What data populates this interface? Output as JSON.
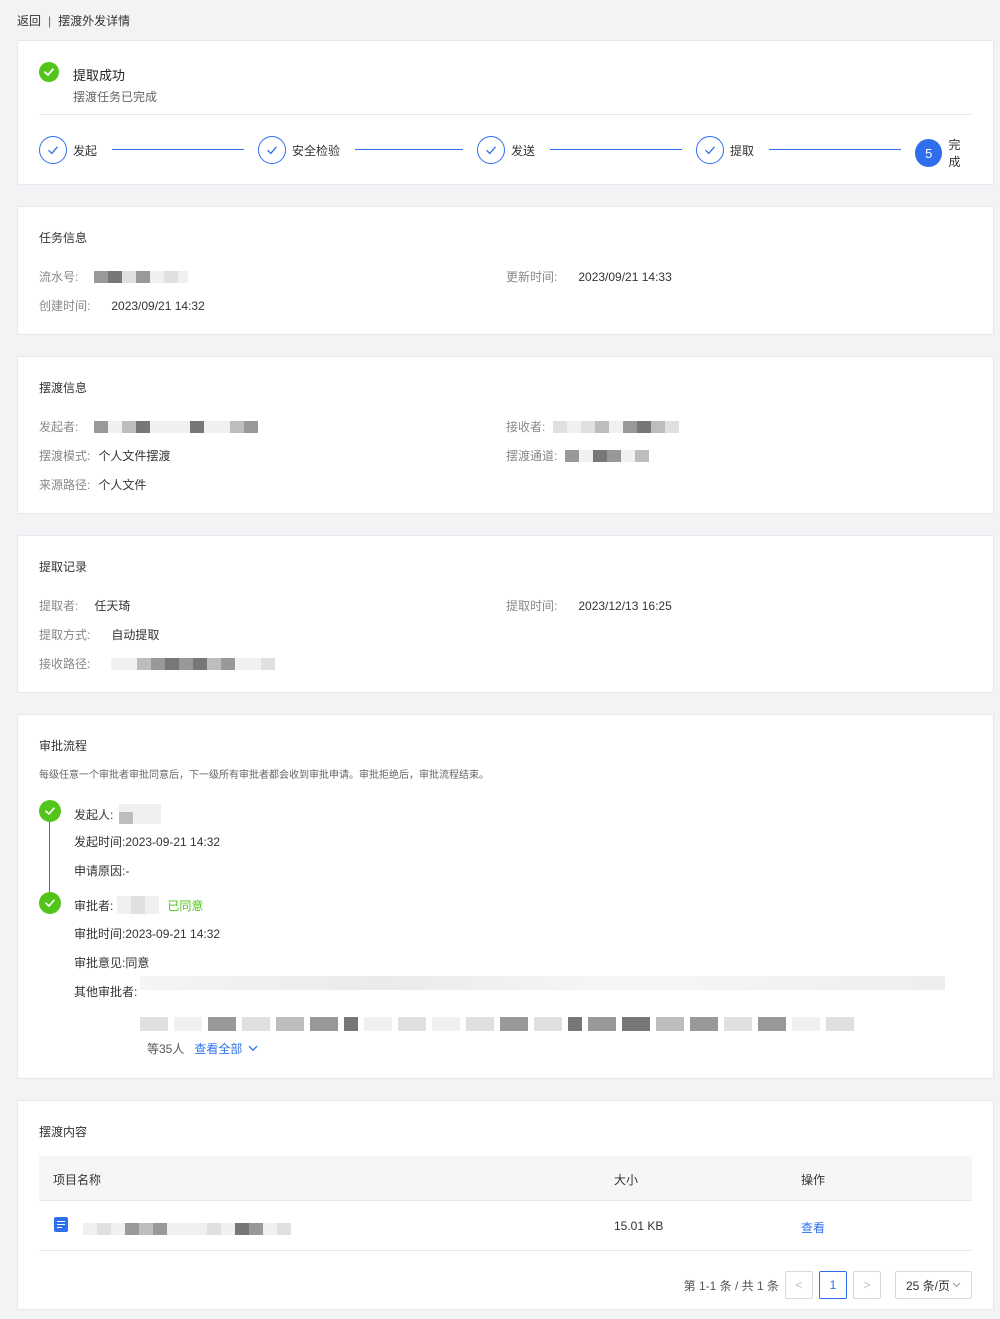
{
  "topbar": {
    "back_label": "返回",
    "separator": "|",
    "page_title": "摆渡外发详情"
  },
  "status": {
    "title": "提取成功",
    "subtitle": "摆渡任务已完成",
    "steps": [
      {
        "label": "发起",
        "state": "done"
      },
      {
        "label": "安全检验",
        "state": "done"
      },
      {
        "label": "发送",
        "state": "done"
      },
      {
        "label": "提取",
        "state": "done"
      },
      {
        "label": "完成",
        "state": "active",
        "number": "5"
      }
    ]
  },
  "task_info": {
    "title": "任务信息",
    "serial_label": "流水号:",
    "created_label": "创建时间:",
    "created_value": "2023/09/21 14:32",
    "updated_label": "更新时间:",
    "updated_value": "2023/09/21 14:33"
  },
  "ferry_info": {
    "title": "摆渡信息",
    "sender_label": "发起者:",
    "mode_label": "摆渡模式:",
    "mode_value": "个人文件摆渡",
    "source_label": "来源路径:",
    "source_value": "个人文件",
    "receiver_label": "接收者:",
    "channel_label": "摆渡通道:"
  },
  "extract_record": {
    "title": "提取记录",
    "extractor_label": "提取者:",
    "extractor_value": "任天琦",
    "method_label": "提取方式:",
    "method_value": "自动提取",
    "path_label": "接收路径:",
    "time_label": "提取时间:",
    "time_value": "2023/12/13 16:25"
  },
  "approval": {
    "title": "审批流程",
    "description": "每级任意一个审批者审批同意后，下一级所有审批者都会收到审批申请。审批拒绝后，审批流程结束。",
    "initiator_label": "发起人:",
    "initiate_time_label": "发起时间:",
    "initiate_time_value": "2023-09-21 14:32",
    "reason_label": "申请原因:",
    "reason_value": "-",
    "approver_label": "审批者:",
    "approver_status": "已同意",
    "approve_time_label": "审批时间:",
    "approve_time_value": "2023-09-21 14:32",
    "opinion_label": "审批意见:",
    "opinion_value": "同意",
    "others_label": "其他审批者:",
    "others_count": "等35人",
    "view_all": "查看全部"
  },
  "content": {
    "title": "摆渡内容",
    "columns": {
      "name": "项目名称",
      "size": "大小",
      "action": "操作"
    },
    "rows": [
      {
        "size": "15.01 KB",
        "action": "查看"
      }
    ],
    "pagination": {
      "summary": "第 1-1 条 / 共 1 条",
      "prev": "<",
      "current": "1",
      "next": ">",
      "page_size": "25 条/页"
    }
  },
  "colors": {
    "accent": "#2f6fed",
    "success": "#52c41a"
  }
}
